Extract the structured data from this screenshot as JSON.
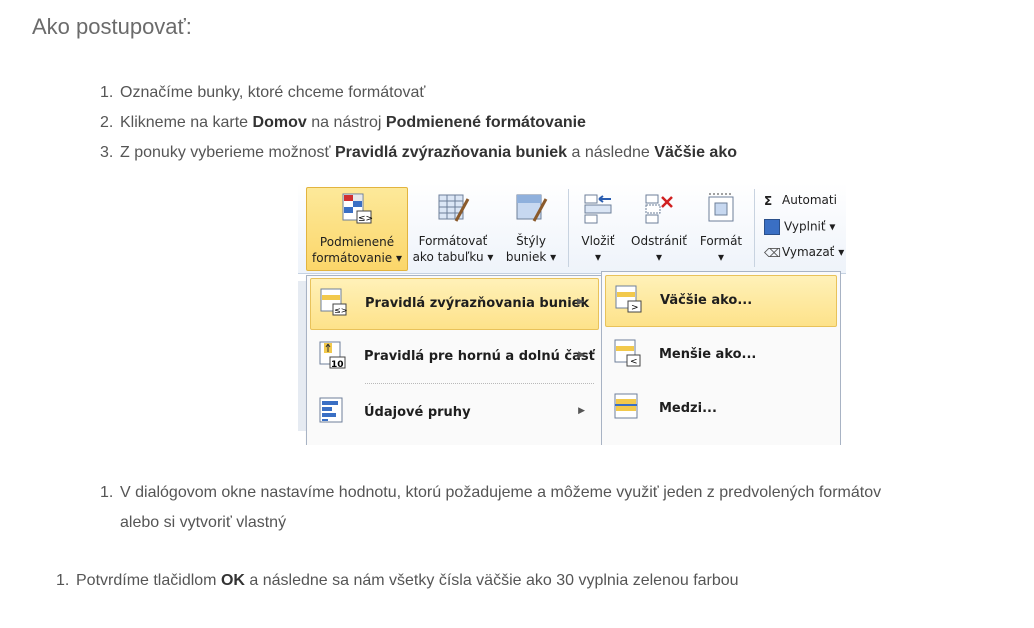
{
  "heading": "Ako postupovať:",
  "steps": [
    {
      "num": "1.",
      "pre": "Označíme bunky, ktoré chceme formátovať",
      "b1": "",
      "mid": "",
      "b2": "",
      "post": ""
    },
    {
      "num": "2.",
      "pre": "Klikneme na karte ",
      "b1": "Domov",
      "mid": " na nástroj ",
      "b2": "Podmienené formátovanie",
      "post": ""
    },
    {
      "num": "3.",
      "pre": "Z ponuky vyberieme možnosť ",
      "b1": "Pravidlá zvýrazňovania buniek",
      "mid": " a následne ",
      "b2": "Väčšie ako",
      "post": ""
    }
  ],
  "step4": {
    "num": "1.",
    "line1": "V dialógovom okne nastavíme hodnotu, ktorú požadujeme a môžeme využiť jeden z predvolených formátov",
    "line2": "alebo si vytvoriť vlastný"
  },
  "step5": {
    "num": "1.",
    "pre": "Potvrdíme tlačidlom ",
    "bold": "OK",
    "post": " a následne sa nám všetky čísla väčšie ako 30 vyplnia zelenou farbou"
  },
  "ribbon": {
    "cond_l1": "Podmienené",
    "cond_l2": "formátovanie ▾",
    "table_l1": "Formátovať",
    "table_l2": "ako tabuľku ▾",
    "styles_l1": "Štýly",
    "styles_l2": "buniek ▾",
    "insert_l1": "Vložiť",
    "insert_l2": "▾",
    "delete_l1": "Odstrániť",
    "delete_l2": "▾",
    "format_l1": "Formát",
    "format_l2": "▾",
    "autosum": "Automati",
    "fill": "Vyplniť ▾",
    "clear": "Vymazať ▾"
  },
  "menu": {
    "item1": "Pravidlá zvýrazňovania buniek",
    "item2": "Pravidlá pre hornú a dolnú časť",
    "item3": "Údajové pruhy"
  },
  "submenu": {
    "item1": "Väčšie ako...",
    "item2": "Menšie ako...",
    "item3": "Medzi..."
  }
}
